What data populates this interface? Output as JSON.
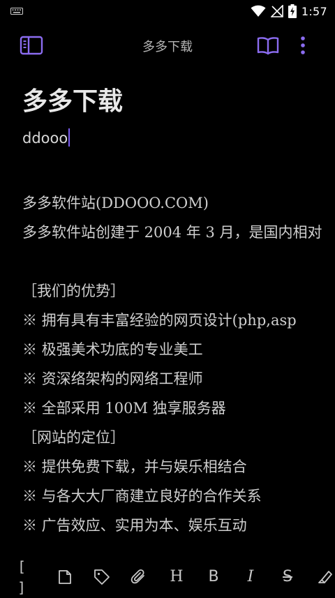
{
  "status_bar": {
    "time": "1:57",
    "icons": [
      "keyboard-icon",
      "wifi-icon",
      "no-signal-icon",
      "battery-charging-icon"
    ]
  },
  "toolbar": {
    "title": "多多下载",
    "icons": [
      "sidebar-toggle-icon",
      "reading-mode-icon",
      "more-vertical-icon"
    ]
  },
  "note": {
    "title": "多多下载",
    "first_line": "ddooo",
    "lines": [
      "",
      "多多软件站(DDOOO.COM)",
      "多多软件站创建于 2004 年 3 月，是国内相对",
      "",
      "［我们的优势］",
      "※ 拥有具有丰富经验的网页设计(php,asp",
      "※ 极强美术功底的专业美工",
      "※ 资深络架构的网络工程师",
      "※ 全部采用 100M 独享服务器",
      "［网站的定位］",
      "※ 提供免费下载，并与娱乐相结合",
      "※ 与各大大厂商建立良好的合作关系",
      "※ 广告效应、实用为本、娱乐互动"
    ]
  },
  "format_bar": {
    "items": [
      {
        "name": "wikilink-icon",
        "glyph": "[ ]"
      },
      {
        "name": "embed-file-icon",
        "glyph": ""
      },
      {
        "name": "tag-icon",
        "glyph": ""
      },
      {
        "name": "attachment-icon",
        "glyph": ""
      },
      {
        "name": "heading-icon",
        "glyph": "H"
      },
      {
        "name": "bold-icon",
        "glyph": "B"
      },
      {
        "name": "italic-icon",
        "glyph": "I"
      },
      {
        "name": "strikethrough-icon",
        "glyph": "S"
      },
      {
        "name": "highlight-icon",
        "glyph": ""
      }
    ]
  },
  "colors": {
    "accent": "#8b6cf0",
    "background": "#000000",
    "text": "#cfcfcf"
  }
}
